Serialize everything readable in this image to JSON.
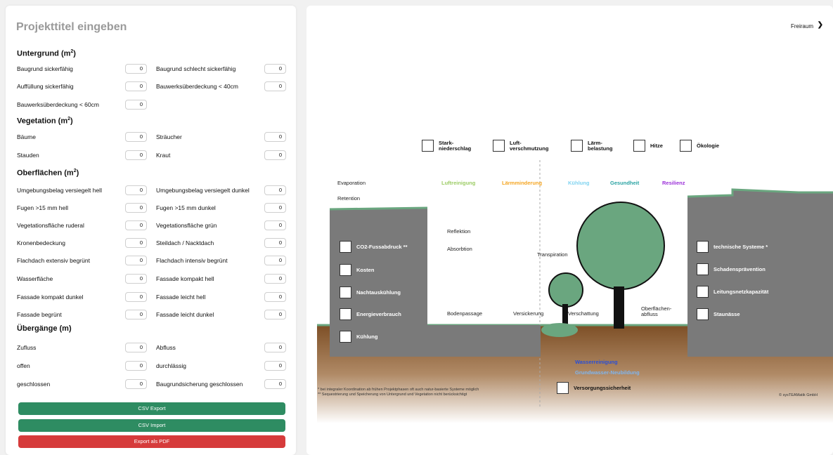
{
  "project": {
    "title_placeholder": "Projekttitel eingeben"
  },
  "sections": {
    "untergrund": "Untergrund (m",
    "vegetation": "Vegetation (m",
    "oberflaechen": "Oberflächen (m",
    "uebergaenge": "Übergänge (m)"
  },
  "rows": [
    {
      "left": "Baugrund sickerfähig",
      "left_value": "0",
      "right": "Baugrund schlecht sickerfähig",
      "right_value": "0"
    },
    {
      "left": "Auffüllung sickerfähig",
      "left_value": "0",
      "right": "Bauwerksüberdeckung < 40cm",
      "right_value": "0"
    },
    {
      "left": "Bauwerksüberdeckung < 60cm",
      "left_value": "0",
      "right": "",
      "right_value": ""
    },
    {
      "left": "Bäume",
      "left_value": "0",
      "right": "Sträucher",
      "right_value": "0"
    },
    {
      "left": "Stauden",
      "left_value": "0",
      "right": "Kraut",
      "right_value": "0"
    },
    {
      "left": "Umgebungsbelag versiegelt hell",
      "left_value": "0",
      "right": "Umgebungsbelag versiegelt dunkel",
      "right_value": "0"
    },
    {
      "left": "Fugen >15 mm hell",
      "left_value": "0",
      "right": "Fugen >15 mm dunkel",
      "right_value": "0"
    },
    {
      "left": "Vegetationsfläche ruderal",
      "left_value": "0",
      "right": "Vegetationsfläche grün",
      "right_value": "0"
    },
    {
      "left": "Kronenbedeckung",
      "left_value": "0",
      "right": "Steildach / Nacktdach",
      "right_value": "0"
    },
    {
      "left": "Flachdach extensiv begrünt",
      "left_value": "0",
      "right": "Flachdach intensiv begrünt",
      "right_value": "0"
    },
    {
      "left": "Wasserfläche",
      "left_value": "0",
      "right": "Fassade kompakt hell",
      "right_value": "0"
    },
    {
      "left": "Fassade kompakt dunkel",
      "left_value": "0",
      "right": "Fassade leicht hell",
      "right_value": "0"
    },
    {
      "left": "Fassade begrünt",
      "left_value": "0",
      "right": "Fassade leicht dunkel",
      "right_value": "0"
    },
    {
      "left": "Zufluss",
      "left_value": "0",
      "right": "Abfluss",
      "right_value": "0"
    },
    {
      "left": "offen",
      "left_value": "0",
      "right": "durchlässig",
      "right_value": "0"
    },
    {
      "left": "geschlossen",
      "left_value": "0",
      "right": "Baugrundsicherung geschlossen",
      "right_value": "0"
    }
  ],
  "buttons": {
    "csv_export": "CSV Export",
    "csv_import": "CSV Import",
    "pdf_export": "Export als PDF"
  },
  "view_select": {
    "value": "Freiraum"
  },
  "top_checks": [
    {
      "label": "Stark-\nniederschlag"
    },
    {
      "label": "Luft-\nverschmutzung"
    },
    {
      "label": "Lärm-\nbelastung"
    },
    {
      "label": "Hitze"
    },
    {
      "label": "Ökologie"
    }
  ],
  "categories": [
    {
      "label": "Evaporation",
      "color": "#222222"
    },
    {
      "label": "Luftreinigung",
      "color": "#9ccc65"
    },
    {
      "label": "Lärmminderung",
      "color": "#f5a623"
    },
    {
      "label": "Kühlung",
      "color": "#7fd3f0"
    },
    {
      "label": "Gesundheit",
      "color": "#2aa3a3"
    },
    {
      "label": "Resilienz",
      "color": "#9b30d9"
    }
  ],
  "retention_label": "Retention",
  "left_building_checks": [
    "CO2-Fussabdruck **",
    "Kosten",
    "Nachtauskühlung",
    "Energieverbrauch",
    "Kühlung"
  ],
  "right_building_checks": [
    "technische Systeme *",
    "Schadensprävention",
    "Leitungsnetzkapazität",
    "Staunässe"
  ],
  "process_labels": {
    "reflektion": "Reflektion",
    "absorbtion": "Absorbtion",
    "transpiration": "Transpiration",
    "bodenpassage": "Bodenpassage",
    "versickerung": "Versickerung",
    "verschattung": "Verschattung",
    "oberflaechenabfluss": "Oberflächen-\nabfluss"
  },
  "ground_labels": {
    "wasserreinigung": "Wasserreinigung",
    "grundwasser": "Grundwasser-Neubildung",
    "versorgung": "Versorgungssicherheit"
  },
  "footnotes": "* bei integraler Koordination ab frühen Projektphasen oft auch natur-basierte Systeme möglich\n** Sequestrierung und Speicherung von Untergrund und Vegetation nicht berücksichtigt",
  "copyright": "© sysTEAMatik GmbH",
  "colors": {
    "green_button": "#2e8c62",
    "red_button": "#d63b3b",
    "building": "#7a7a7a",
    "roof_green": "#6aa67f",
    "soil": "#8b5a2b"
  }
}
